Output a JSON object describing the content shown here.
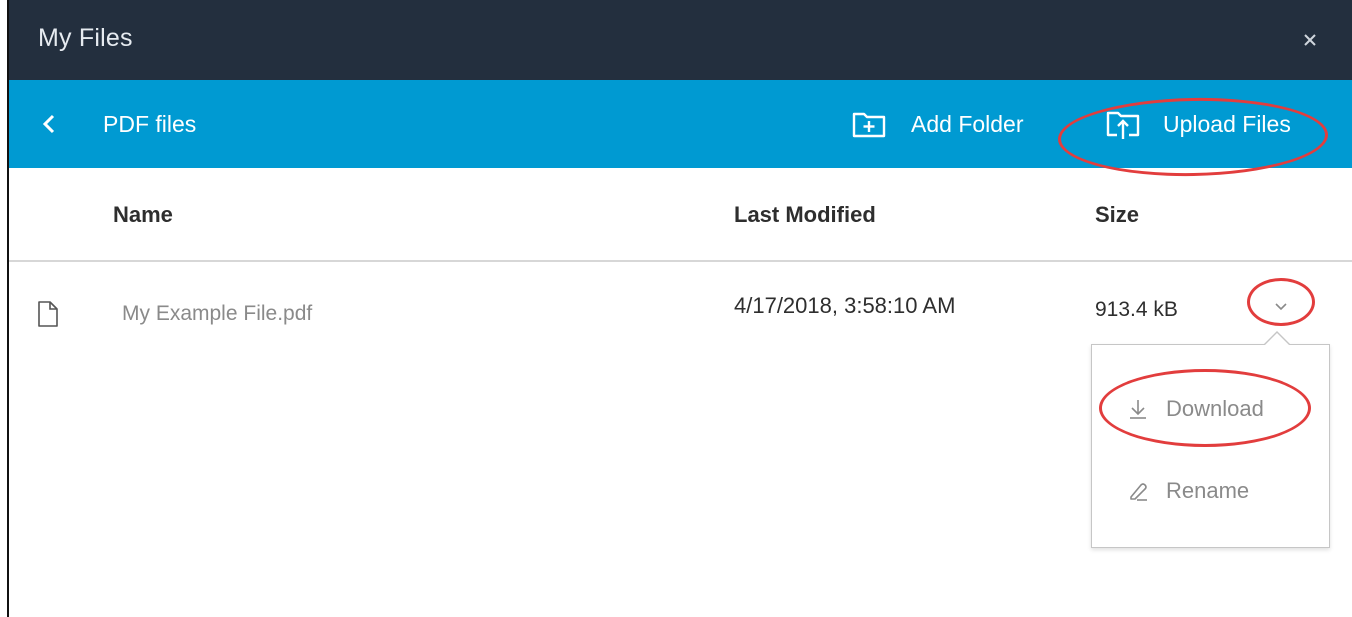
{
  "window": {
    "title": "My Files",
    "close_icon": "close-icon"
  },
  "toolbar": {
    "back_icon": "chevron-left-icon",
    "current_folder": "PDF files",
    "add_folder_label": "Add Folder",
    "add_folder_icon": "folder-plus-icon",
    "upload_files_label": "Upload Files",
    "upload_files_icon": "folder-upload-icon"
  },
  "table": {
    "columns": [
      "Name",
      "Last Modified",
      "Size"
    ],
    "rows": [
      {
        "icon": "file-icon",
        "name": "My Example File.pdf",
        "last_modified": "4/17/2018, 3:58:10 AM",
        "size": "913.4 kB",
        "menu_icon": "chevron-down-icon"
      }
    ]
  },
  "row_menu": {
    "items": [
      {
        "label": "Download",
        "icon": "download-icon"
      },
      {
        "label": "Rename",
        "icon": "pencil-icon"
      }
    ]
  },
  "colors": {
    "titlebar_bg": "#232f3e",
    "toolbar_bg": "#009ad2",
    "annotation": "#e23d3d"
  }
}
